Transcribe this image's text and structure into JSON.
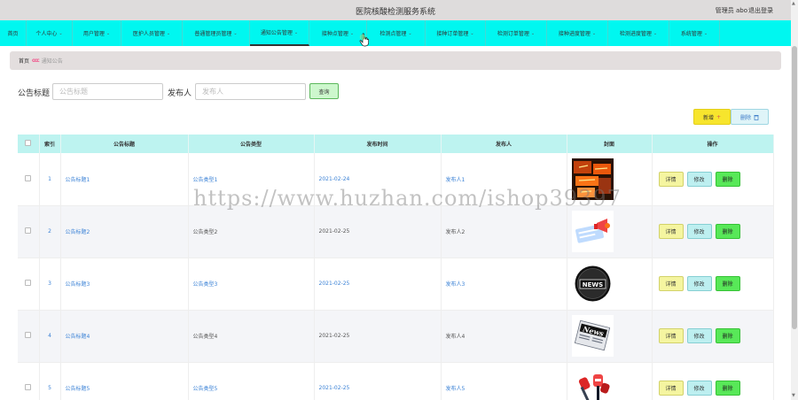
{
  "header": {
    "title": "医院核酸检测服务系统",
    "user": "管理员 abo",
    "logout": "退出登录"
  },
  "nav": [
    {
      "label": "首页",
      "chevron": false
    },
    {
      "label": "个人中心",
      "chevron": true
    },
    {
      "label": "用户管理",
      "chevron": true
    },
    {
      "label": "医护人员管理",
      "chevron": true
    },
    {
      "label": "普通管理员管理",
      "chevron": true
    },
    {
      "label": "通知公告管理",
      "chevron": true,
      "active": true
    },
    {
      "label": "接种点管理",
      "chevron": true
    },
    {
      "label": "检测点管理",
      "chevron": true
    },
    {
      "label": "接种订单管理",
      "chevron": true
    },
    {
      "label": "检测订单管理",
      "chevron": true
    },
    {
      "label": "接种进度管理",
      "chevron": true
    },
    {
      "label": "检测进度管理",
      "chevron": true
    },
    {
      "label": "系统管理",
      "chevron": true
    }
  ],
  "breadcrumb": {
    "home": "首页",
    "separator": "ccc",
    "current": "通知公告"
  },
  "search": {
    "title_label": "公告标题",
    "title_placeholder": "公告标题",
    "publisher_label": "发布人",
    "publisher_placeholder": "发布人",
    "search_button": "查询"
  },
  "actions": {
    "add_label": "新增",
    "add_icon": "+",
    "delete_label": "删除",
    "delete_icon": "trash-icon"
  },
  "table": {
    "columns": [
      "索引",
      "公告标题",
      "公告类型",
      "发布时间",
      "发布人",
      "封面",
      "操作"
    ],
    "row_buttons": {
      "detail": "详情",
      "edit": "修改",
      "delete": "删除"
    },
    "rows": [
      {
        "index": "1",
        "title": "公告标题1",
        "type": "公告类型1",
        "time": "2021-02-24",
        "publisher": "发布人1",
        "cover": "news-collage-image"
      },
      {
        "index": "2",
        "title": "公告标题2",
        "type": "公告类型2",
        "time": "2021-02-25",
        "publisher": "发布人2",
        "cover": "megaphone-news-image"
      },
      {
        "index": "3",
        "title": "公告标题3",
        "type": "公告类型3",
        "time": "2021-02-25",
        "publisher": "发布人3",
        "cover": "news-globe-badge-image"
      },
      {
        "index": "4",
        "title": "公告标题4",
        "type": "公告类型4",
        "time": "2021-02-25",
        "publisher": "发布人4",
        "cover": "newspaper-news-image"
      },
      {
        "index": "5",
        "title": "公告标题5",
        "type": "公告类型5",
        "time": "2021-02-25",
        "publisher": "发布人5",
        "cover": "microphones-image"
      }
    ]
  },
  "watermark": "https://www.huzhan.com/ishop39397",
  "colors": {
    "nav_bg": "#00f7f0",
    "header_bg": "#dedcdc",
    "table_header_bg": "#bdf3f0",
    "link_blue": "#3b82d6",
    "add_yellow": "#f7e52d",
    "delete_green": "#58e858"
  }
}
